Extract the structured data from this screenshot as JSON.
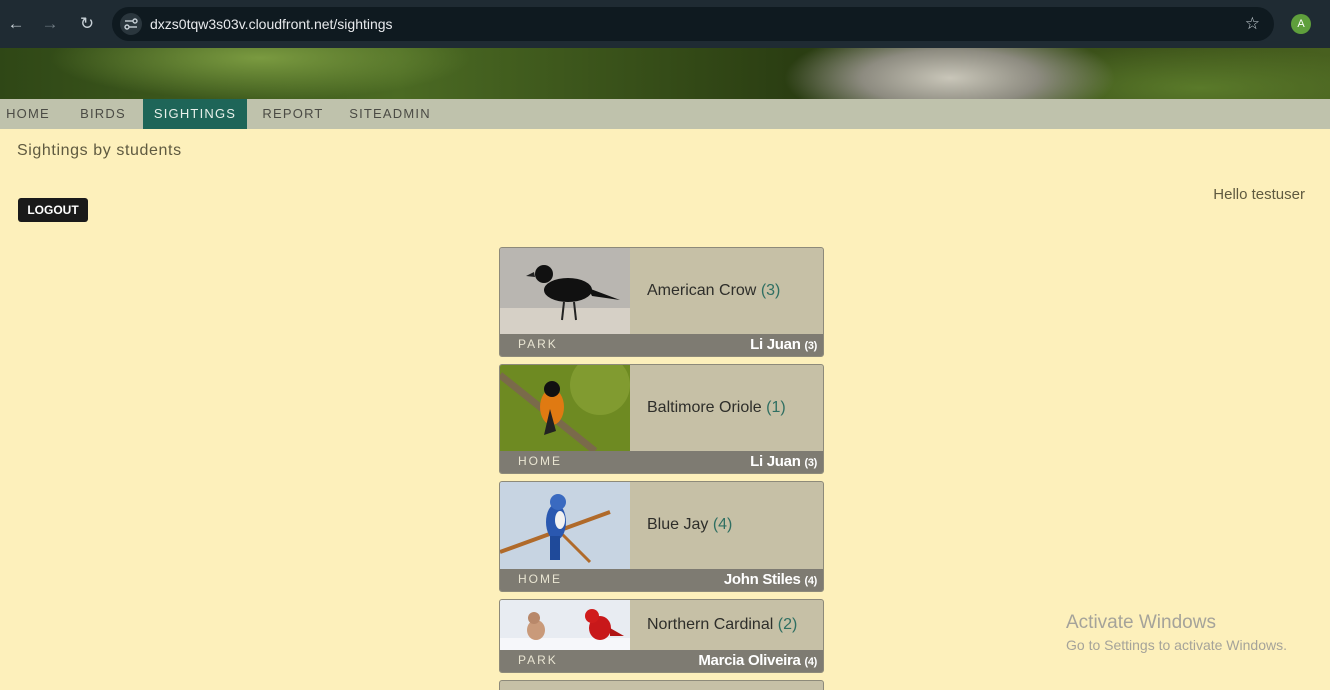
{
  "browser": {
    "back_icon": "arrow-left-icon",
    "forward_icon": "arrow-right-icon",
    "reload_icon": "reload-icon",
    "url": "dxzs0tqw3s03v.cloudfront.net/sightings",
    "avatar_letter": "A"
  },
  "nav": {
    "items": [
      {
        "label": "HOME"
      },
      {
        "label": "BIRDS"
      },
      {
        "label": "SIGHTINGS",
        "active": true
      },
      {
        "label": "REPORT"
      },
      {
        "label": "SITEADMIN"
      }
    ]
  },
  "page": {
    "subtitle": "Sightings by students",
    "logout_label": "LOGOUT",
    "greeting": "Hello testuser"
  },
  "sightings": [
    {
      "bird": "American Crow",
      "count": "(3)",
      "location": "PARK",
      "student": "Li Juan",
      "student_count": "(3)"
    },
    {
      "bird": "Baltimore Oriole",
      "count": "(1)",
      "location": "HOME",
      "student": "Li Juan",
      "student_count": "(3)"
    },
    {
      "bird": "Blue Jay",
      "count": "(4)",
      "location": "HOME",
      "student": "John Stiles",
      "student_count": "(4)"
    },
    {
      "bird": "Northern Cardinal",
      "count": "(2)",
      "location": "PARK",
      "student": "Marcia Oliveira",
      "student_count": "(4)"
    }
  ],
  "watermark": {
    "line1": "Activate Windows",
    "line2": "Go to Settings to activate Windows."
  },
  "colors": {
    "page_bg": "#fdf0bb",
    "nav_bg": "#bfc2ac",
    "nav_active": "#1e6558",
    "card_bg": "#c6c0a6",
    "card_footer": "#7e7b72"
  }
}
